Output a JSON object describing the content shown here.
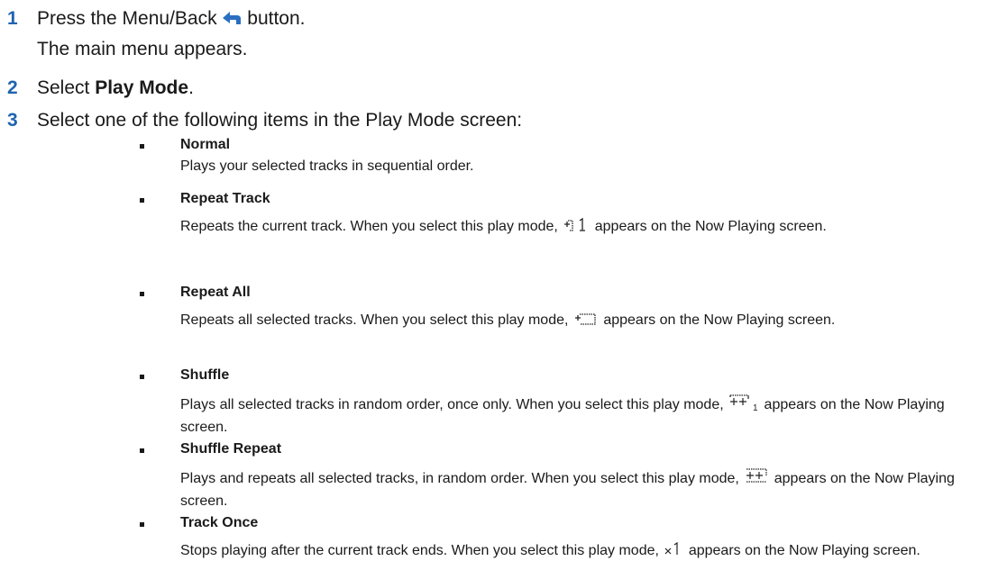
{
  "steps": [
    {
      "num": "1",
      "text_before": "Press the Menu/Back ",
      "text_after": " button.",
      "subtext": "The main menu appears."
    },
    {
      "num": "2",
      "text_before": "Select ",
      "bold": "Play Mode",
      "text_after": "."
    },
    {
      "num": "3",
      "text": "Select one of the following items in the Play Mode screen:"
    }
  ],
  "modes": [
    {
      "title": "Normal",
      "desc": "Plays your selected tracks in sequential order."
    },
    {
      "title": "Repeat Track",
      "desc_before": "Repeats the current track. When you select this play mode, ",
      "desc_after": " appears on the Now Playing screen.",
      "icon": "repeat-one-icon"
    },
    {
      "title": "Repeat All",
      "desc_before": "Repeats all selected tracks. When you select this play mode, ",
      "desc_after": " appears on the Now Playing screen.",
      "icon": "repeat-all-icon"
    },
    {
      "title": "Shuffle",
      "desc_before": "Plays all selected tracks in random order, once only. When you select this play mode, ",
      "desc_after": " appears on the Now Playing screen.",
      "icon": "shuffle-once-icon"
    },
    {
      "title": "Shuffle Repeat",
      "desc_before": "Plays and repeats all selected tracks, in random order. When you select this play mode, ",
      "desc_after": " appears on the Now Playing screen.",
      "icon": "shuffle-repeat-icon"
    },
    {
      "title": "Track Once",
      "desc_before": "Stops playing after the current track ends. When you select this play mode, ",
      "desc_after": " appears on the Now Playing screen.",
      "icon": "track-once-icon"
    }
  ],
  "colors": {
    "step_number": "#1f64b0",
    "back_icon": "#2a6fc0",
    "text": "#1a1a1a"
  }
}
